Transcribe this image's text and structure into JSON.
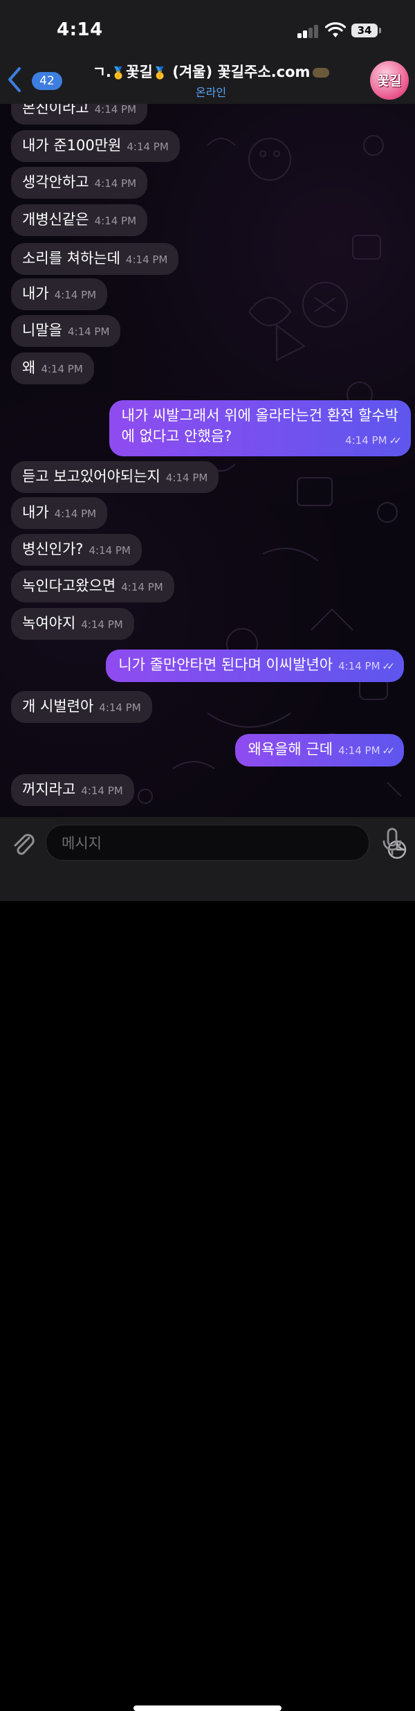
{
  "status_bar": {
    "time": "4:14",
    "battery": "34"
  },
  "header": {
    "back_count": "42",
    "title_prefix": "ㄱ.",
    "title_medal": "🥇",
    "title_name": "꽃길",
    "title_suffix": "(겨울) 꽃길주소.com",
    "status": "온라인",
    "avatar_text": "꽃길"
  },
  "messages": [
    {
      "dir": "in",
      "text": "본진이라고",
      "time": "4:14 PM"
    },
    {
      "dir": "in",
      "text": "내가 준100만원",
      "time": "4:14 PM"
    },
    {
      "dir": "in",
      "text": "생각안하고",
      "time": "4:14 PM"
    },
    {
      "dir": "in",
      "text": "개병신같은",
      "time": "4:14 PM"
    },
    {
      "dir": "in",
      "text": "소리를 쳐하는데",
      "time": "4:14 PM"
    },
    {
      "dir": "in",
      "text": "내가",
      "time": "4:14 PM"
    },
    {
      "dir": "in",
      "text": "니말을",
      "time": "4:14 PM"
    },
    {
      "dir": "in",
      "text": "왜",
      "time": "4:14 PM"
    },
    {
      "dir": "out",
      "line1": "내가  씨발그래서 위에 올라타는건 환전 할수박",
      "line2": "에 없다고 안했음?",
      "time": "4:14 PM"
    },
    {
      "dir": "in",
      "text": "듣고 보고있어야되는지",
      "time": "4:14 PM"
    },
    {
      "dir": "in",
      "text": "내가",
      "time": "4:14 PM"
    },
    {
      "dir": "in",
      "text": "병신인가?",
      "time": "4:14 PM"
    },
    {
      "dir": "in",
      "text": "녹인다고왔으면",
      "time": "4:14 PM"
    },
    {
      "dir": "in",
      "text": "녹여야지",
      "time": "4:14 PM"
    },
    {
      "dir": "out",
      "text": "니가 줄만안타면 된다며 이씨발년아",
      "time": "4:14 PM"
    },
    {
      "dir": "in",
      "text": "개 시벌련아",
      "time": "4:14 PM"
    },
    {
      "dir": "out",
      "text": "왜욕을해 근데",
      "time": "4:14 PM"
    },
    {
      "dir": "in",
      "text": "꺼지라고",
      "time": "4:14 PM"
    }
  ],
  "input": {
    "placeholder": "메시지"
  },
  "icons": {
    "back": "chevron-left-icon",
    "attach": "paperclip-icon",
    "sticker": "sticker-icon",
    "mic": "microphone-icon",
    "read": "double-check-icon"
  },
  "colors": {
    "accent": "#3d7ee0",
    "online": "#5aa3f5",
    "incoming_bubble": "#29242e",
    "outgoing_bubble_start": "#8f4cf0",
    "outgoing_bubble_end": "#5e56ee"
  }
}
